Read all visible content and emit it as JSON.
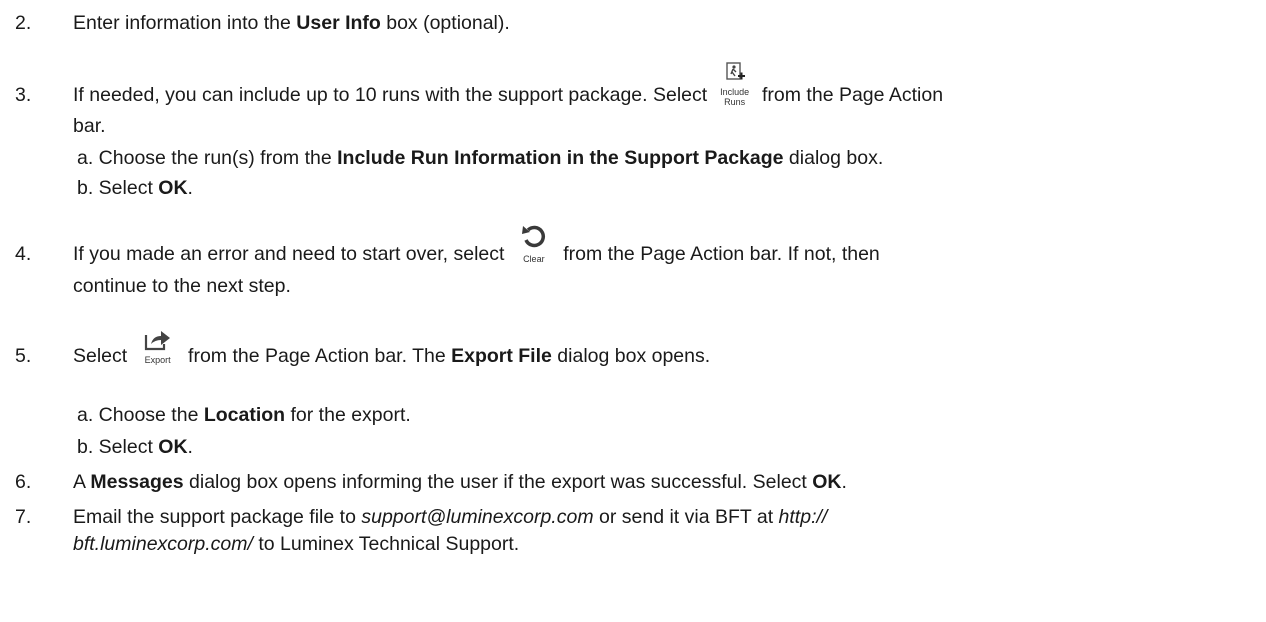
{
  "steps": [
    {
      "num": "2.",
      "pre": "Enter information into the ",
      "bold": "User Info",
      "post": " box (optional)."
    },
    {
      "num": "3.",
      "pre": "If needed, you can include up to 10 runs with the support package. Select ",
      "icon_label_1": "Include",
      "icon_label_2": "Runs",
      "post": " from the Page Action",
      "cont": "bar.",
      "subs": [
        {
          "pre": "a. Choose the run(s) from the ",
          "bold": "Include Run Information in the Support Package",
          "post": " dialog box."
        },
        {
          "pre": "b. Select ",
          "bold": "OK",
          "post": "."
        }
      ]
    },
    {
      "num": "4.",
      "pre": "If you made an error and need to start over, select ",
      "icon_label": "Clear",
      "post": " from the Page Action bar. If not, then",
      "cont": "continue to the next step."
    },
    {
      "num": "5.",
      "pre": "Select ",
      "icon_label": "Export",
      "mid": " from the Page Action bar. The ",
      "bold": "Export File",
      "post": " dialog box opens.",
      "subs": [
        {
          "pre": "a. Choose the ",
          "bold": "Location",
          "post": " for the export."
        },
        {
          "pre": "b. Select ",
          "bold": "OK",
          "post": "."
        }
      ]
    },
    {
      "num": "6.",
      "pre": "A ",
      "bold": "Messages",
      "mid": " dialog box opens informing the user if the export was successful. Select ",
      "bold2": "OK",
      "post": "."
    },
    {
      "num": "7.",
      "pre": "Email the support package file to ",
      "ital": "support@luminexcorp.com",
      "mid": " or send it via BFT at ",
      "ital2": "http://",
      "cont_ital": "bft.luminexcorp.com/",
      "cont_post": " to Luminex Technical Support."
    }
  ],
  "icons": {
    "include_runs": "include-runs-icon",
    "clear": "clear-icon",
    "export": "export-icon"
  }
}
